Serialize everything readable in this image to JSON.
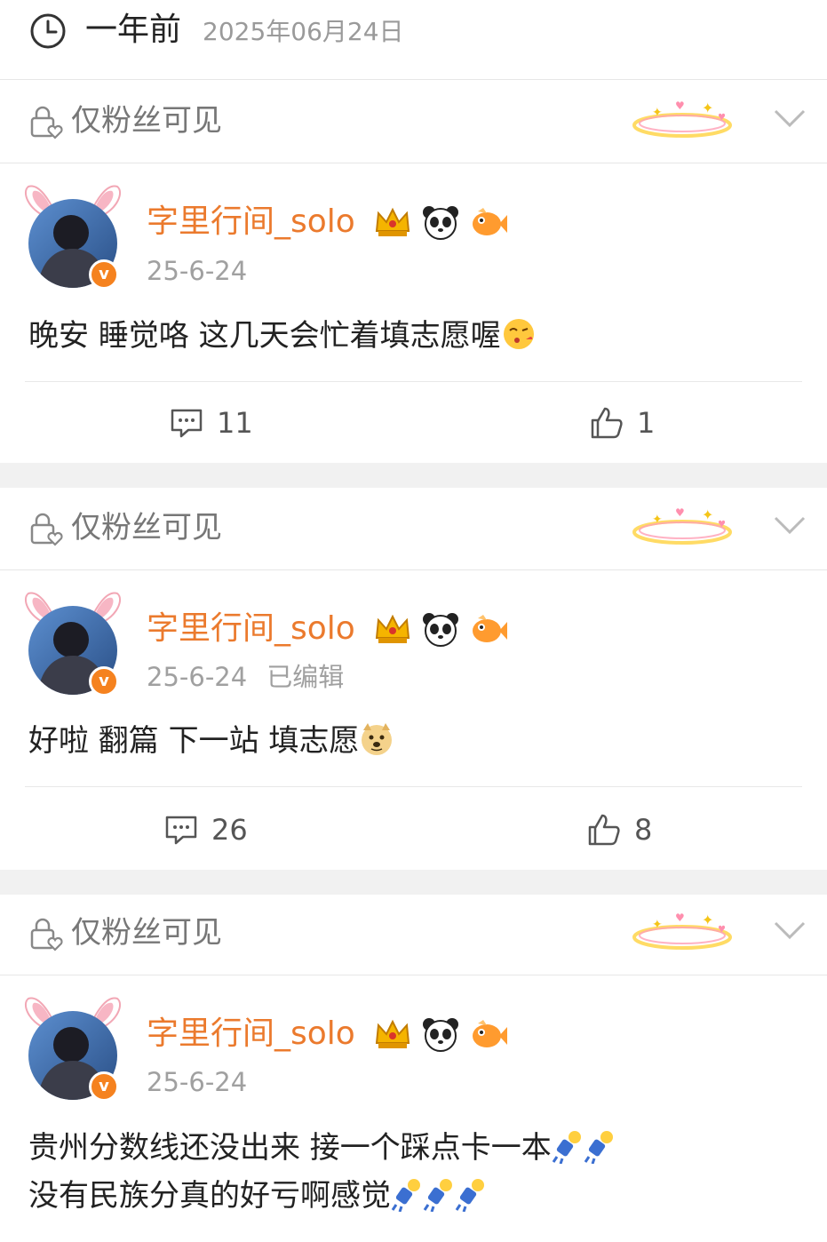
{
  "header": {
    "relative_time": "一年前",
    "absolute_date": "2025年06月24日",
    "clock_icon": "clock-icon"
  },
  "posts": [
    {
      "visibility": "仅粉丝可见",
      "username": "字里行间_solo",
      "date": "25-6-24",
      "edited": "",
      "content_lines": [
        "晚安 睡觉咯 这几天会忙着填志愿喔"
      ],
      "emoji_after_line": [
        "face-blowing-kiss-emoji"
      ],
      "comments": "11",
      "likes": "1"
    },
    {
      "visibility": "仅粉丝可见",
      "username": "字里行间_solo",
      "date": "25-6-24",
      "edited": "已编辑",
      "content_lines": [
        "好啦 翻篇  下一站 填志愿"
      ],
      "emoji_after_line": [
        "doge-emoji"
      ],
      "comments": "26",
      "likes": "8"
    },
    {
      "visibility": "仅粉丝可见",
      "username": "字里行间_solo",
      "date": "25-6-24",
      "edited": "",
      "content_lines": [
        "贵州分数线还没出来 接一个踩点卡一本",
        "没有民族分真的好亏啊感觉"
      ],
      "emoji_after_line": [
        "falling-person-emoji",
        "falling-person-emoji"
      ],
      "comments": "",
      "likes": ""
    }
  ],
  "colors": {
    "username": "#eb7a2d",
    "verified_badge": "#f5821f",
    "muted_text": "#9a9a9a",
    "separator_band": "#f1f1f1"
  }
}
